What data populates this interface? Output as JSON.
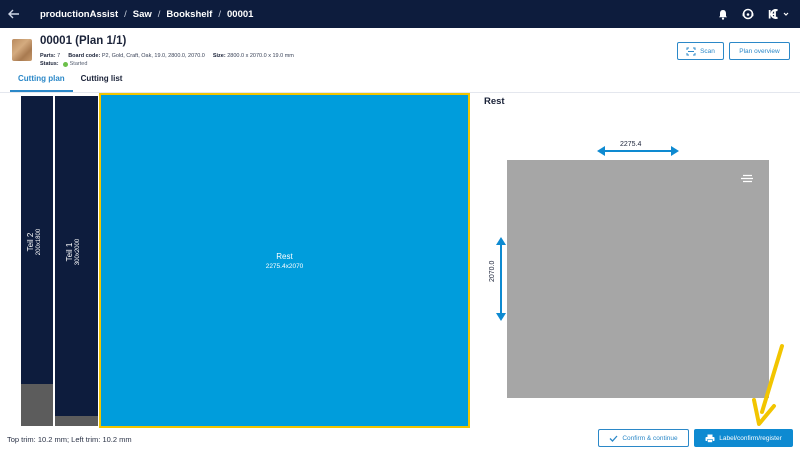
{
  "topbar": {
    "breadcrumbs": [
      "productionAssist",
      "Saw",
      "Bookshelf",
      "00001"
    ],
    "separator": "/",
    "back_icon": "arrow-left-icon",
    "icons": [
      "bell-icon",
      "support-icon",
      "brand-logo-icon"
    ]
  },
  "header": {
    "title": "00001 (Plan 1/1)",
    "parts_label": "Parts:",
    "parts_value": "7",
    "board_code_label": "Board code:",
    "board_code_value": "P2, Gold, Craft, Oak, 19.0, 2800.0, 2070.0",
    "size_label": "Size:",
    "size_value": "2800.0 x 2070.0 x 19.0 mm",
    "status_label": "Status:",
    "status_value": "Started",
    "status_color": "#6cc04a",
    "scan_label": "Scan",
    "plan_overview_label": "Plan overview"
  },
  "tabs": [
    {
      "label": "Cutting plan",
      "active": true
    },
    {
      "label": "Cutting list",
      "active": false
    }
  ],
  "cutting_plan": {
    "parts": [
      {
        "name": "Teil 2",
        "dims": "200x1800"
      },
      {
        "name": "Teil 1",
        "dims": "300x2000"
      }
    ],
    "rest": {
      "label": "Rest",
      "dims": "2275.4x2070"
    },
    "trim_text": "Top trim: 10.2 mm; Left trim: 10.2 mm",
    "colors": {
      "part": "#0d1c3d",
      "rest": "#009ddc",
      "highlight": "#f2c500",
      "waste": "#5c5c5c"
    }
  },
  "rest_panel": {
    "title": "Rest",
    "width_label": "2275.4",
    "height_label": "2070.0",
    "preview_color": "#a6a6a6"
  },
  "actions": {
    "confirm_label": "Confirm & continue",
    "label_confirm_register": "Label/confirm/register"
  },
  "accent_color": "#2b88c8"
}
